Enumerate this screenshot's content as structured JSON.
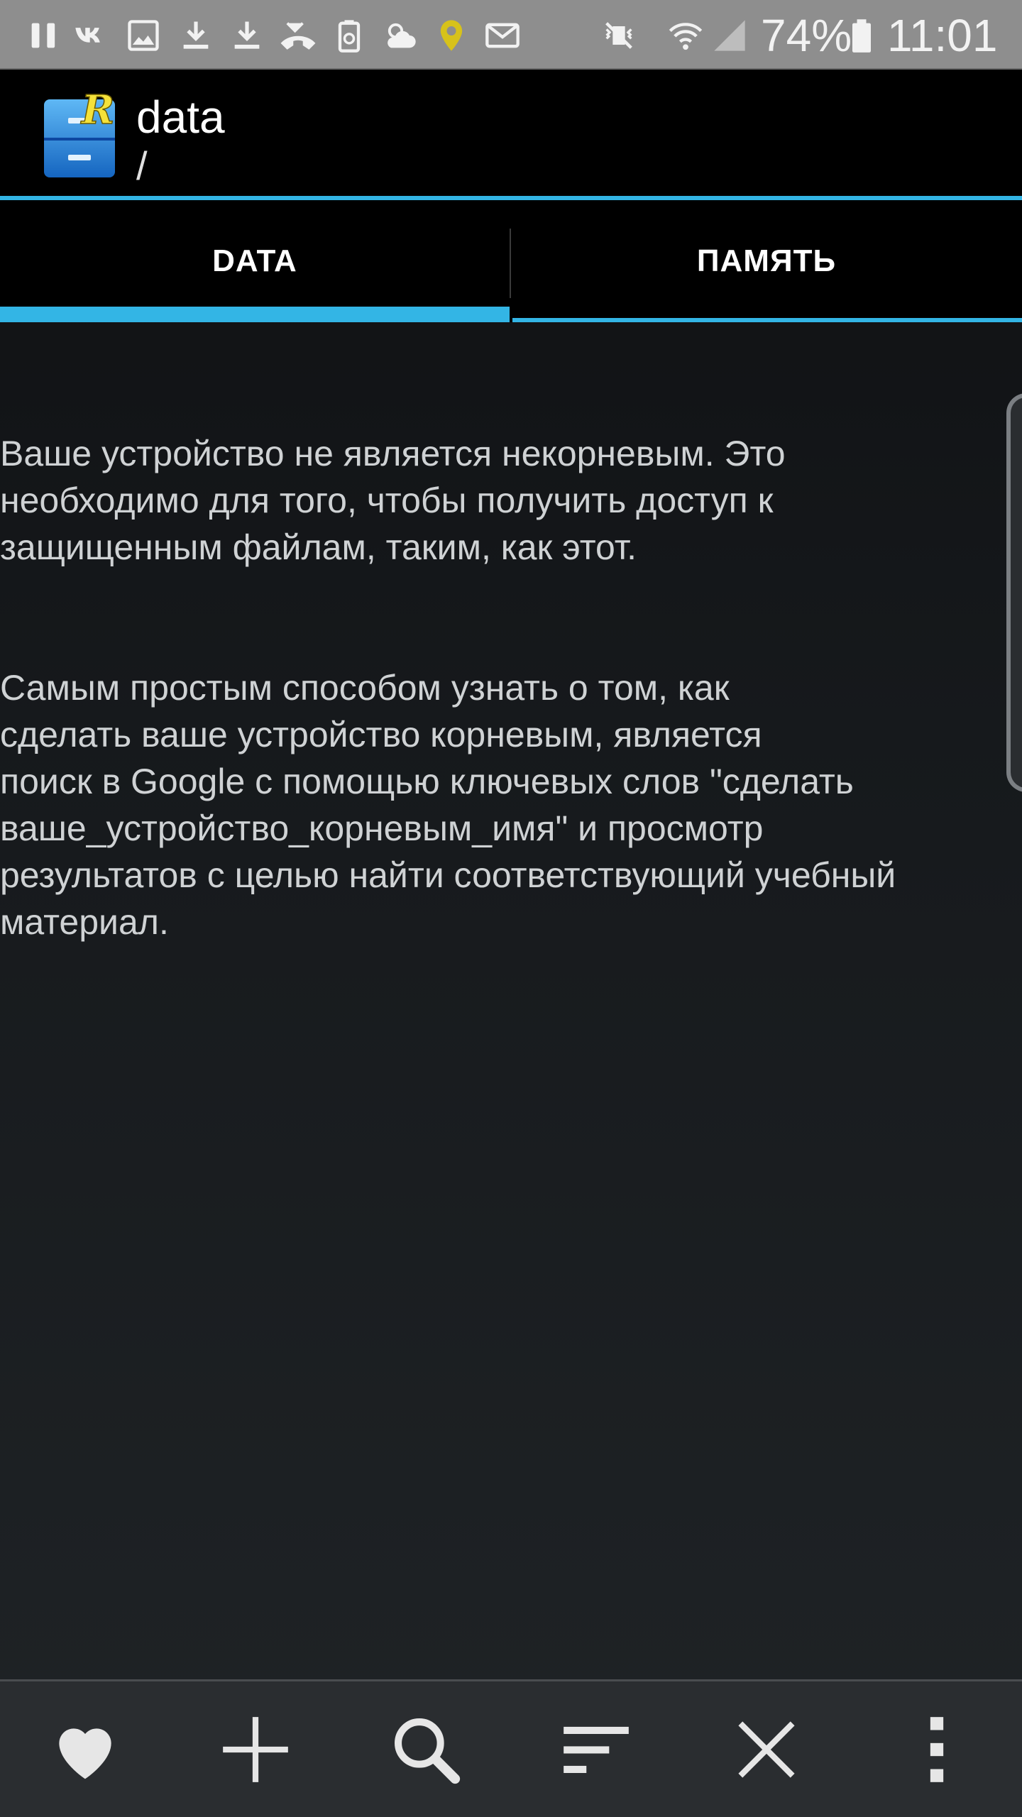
{
  "status_bar": {
    "battery": "74%",
    "time": "11:01",
    "icons": [
      "pause-icon",
      "vk-icon",
      "image-icon",
      "download-icon",
      "download-icon",
      "missed-call-icon",
      "battery-saver-icon",
      "weather-icon",
      "location-pin-icon",
      "mail-icon",
      "mute-icon",
      "wifi-icon",
      "signal-icon",
      "battery-icon"
    ],
    "colors": {
      "background": "#8e8e8e",
      "text": "#f2f2f2",
      "pin": "#d7c21a"
    }
  },
  "app_bar": {
    "title": "data",
    "subtitle": "/",
    "logo_letter": "R",
    "colors": {
      "accent": "#33b5e5",
      "logo_blue": "#1e88e5",
      "logo_letter": "#f5e23a"
    }
  },
  "tabs": [
    {
      "label": "DATA",
      "active": true
    },
    {
      "label": "ПАМЯТЬ",
      "active": false
    }
  ],
  "content": {
    "paragraph_1": "Ваше устройство не является некорневым. Это\nнеобходимо для того, чтобы получить доступ к\nзащищенным файлам, таким, как этот.",
    "paragraph_2": "Самым простым способом узнать о том, как\nсделать ваше устройство корневым, является\nпоиск в Google с помощью ключевых слов \"сделать\nваше_устройство_корневым_имя\" и просмотр\nрезультатов с целью найти соответствующий учебный\nматериал."
  },
  "toolbar": {
    "buttons": [
      "favorite-icon",
      "add-icon",
      "search-icon",
      "sort-icon",
      "close-icon",
      "more-icon"
    ]
  }
}
